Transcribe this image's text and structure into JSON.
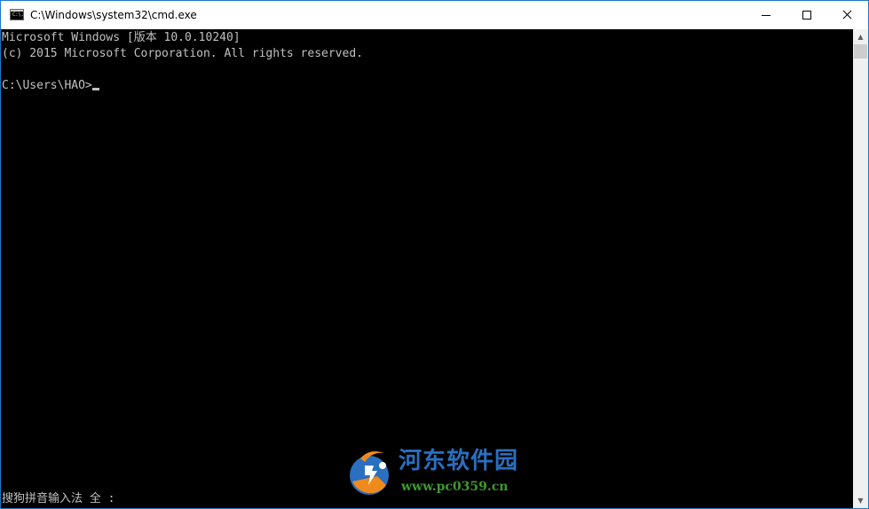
{
  "window": {
    "title": "C:\\Windows\\system32\\cmd.exe",
    "icon": "console-app-icon",
    "icon_text": "C:\\."
  },
  "controls": {
    "minimize_icon": "minimize-icon",
    "maximize_icon": "maximize-icon",
    "close_icon": "close-icon"
  },
  "console": {
    "lines": [
      "Microsoft Windows [版本 10.0.10240]",
      "(c) 2015 Microsoft Corporation. All rights reserved.",
      "C:\\Users\\HAO>"
    ],
    "ime_status": "搜狗拼音输入法 全 :"
  },
  "scrollbar": {
    "up_arrow": "▲",
    "down_arrow": "▼"
  },
  "watermark": {
    "name": "河东软件园",
    "url": "www.pc0359.cn"
  },
  "colors": {
    "console_background": "#000000",
    "console_text": "#c0c0c0",
    "window_border": "#1979ca",
    "watermark_blue": "#2a6fc0",
    "watermark_green": "#3d9a2c",
    "watermark_orange": "#f08a1c"
  }
}
